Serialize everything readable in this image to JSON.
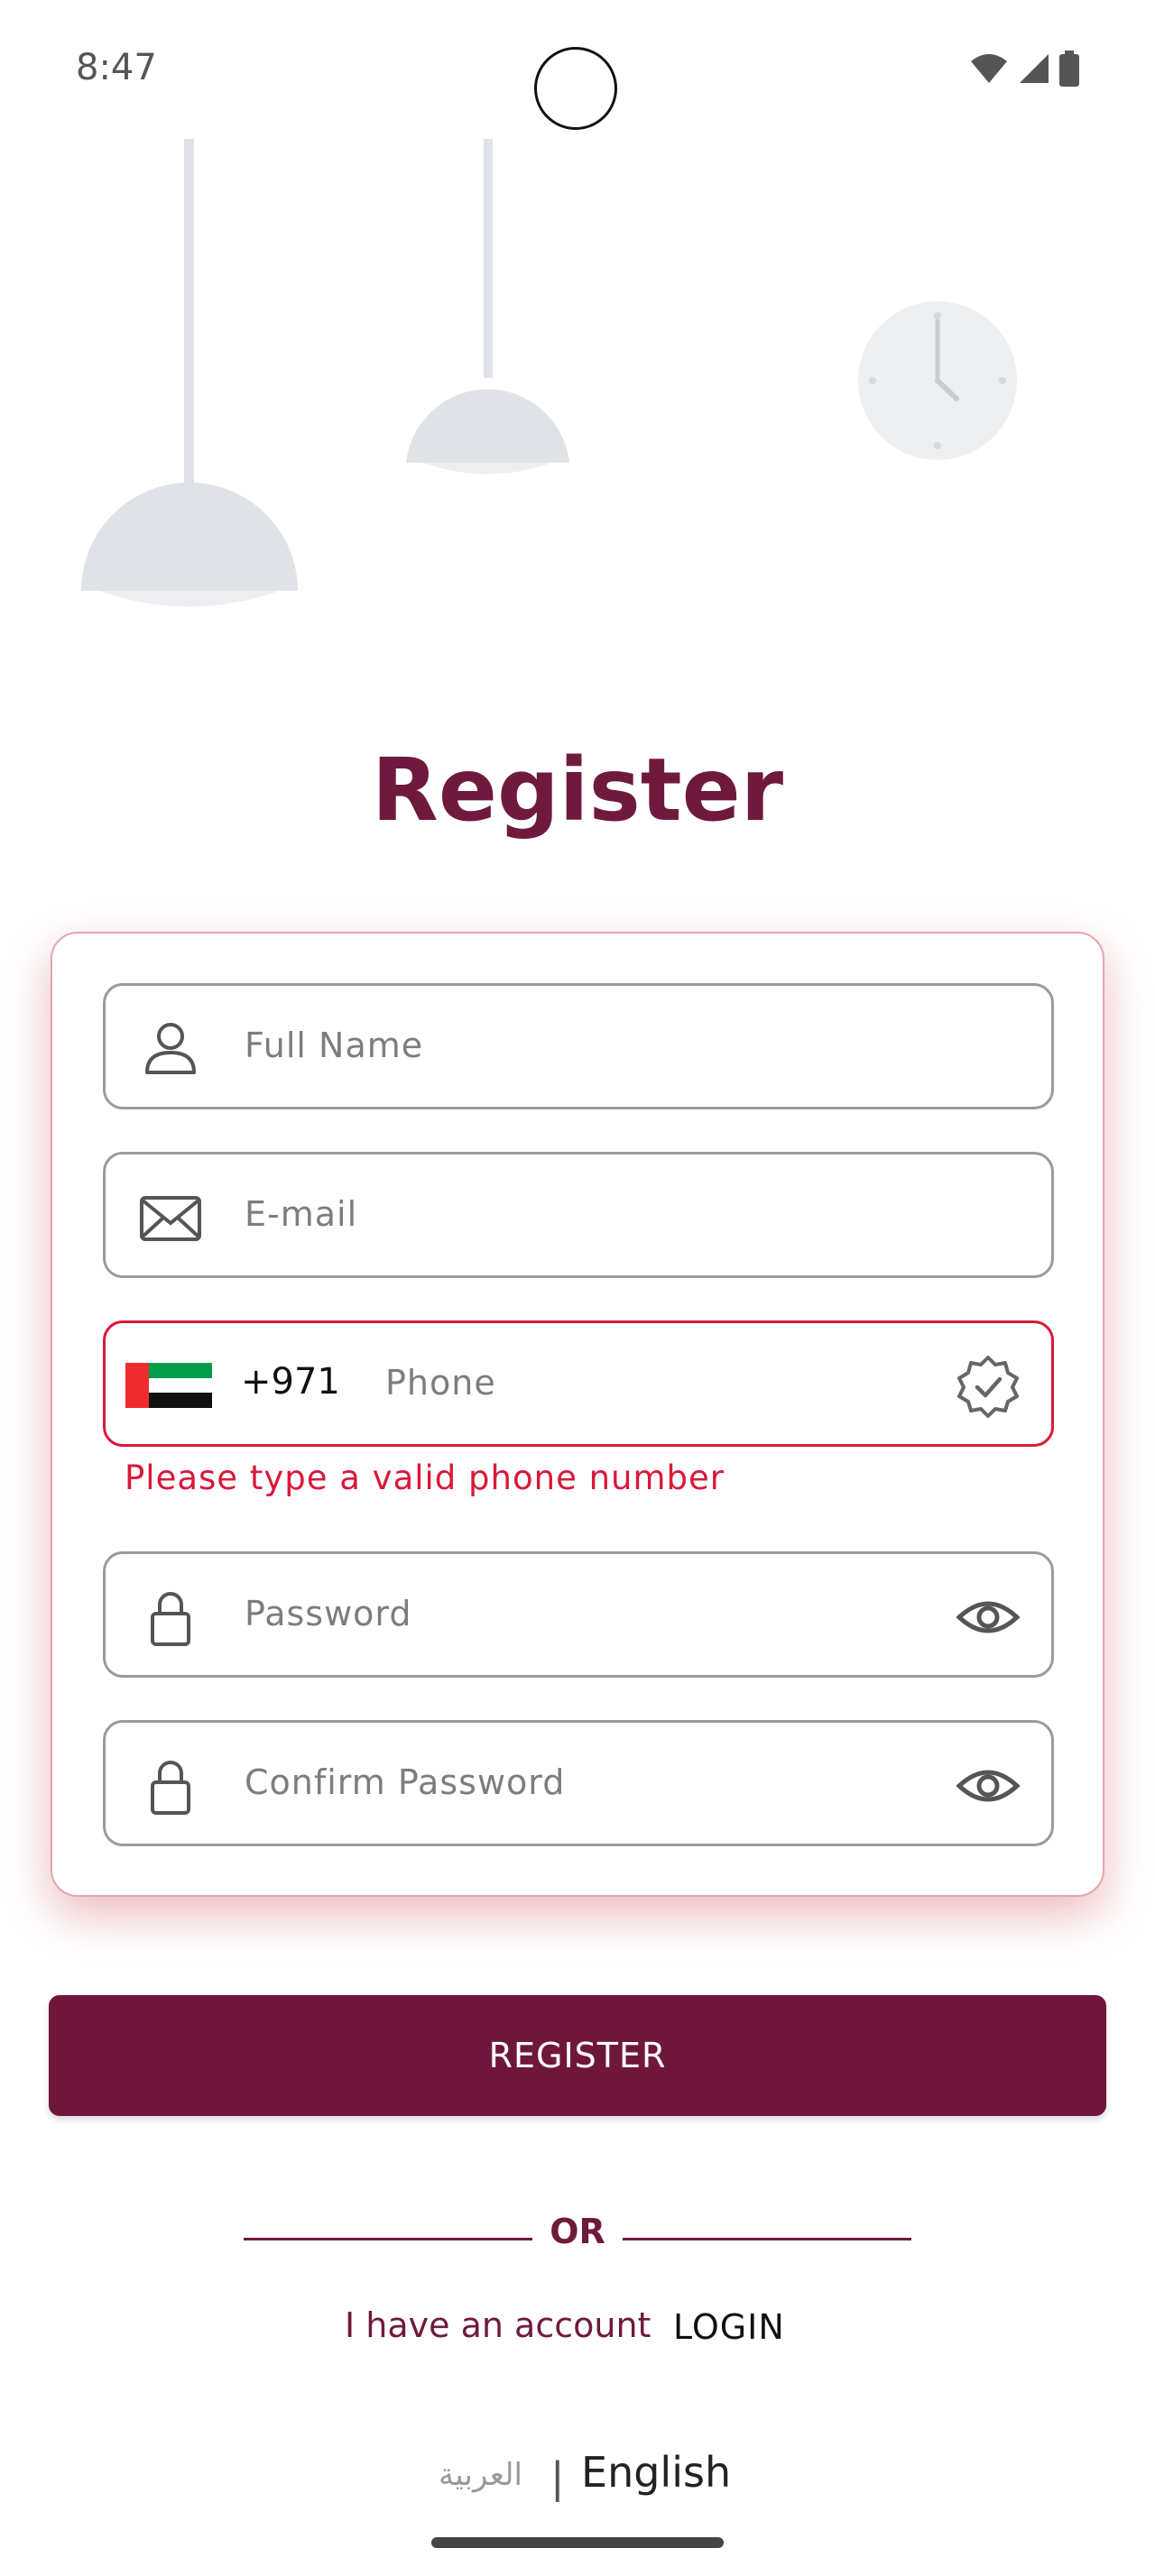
{
  "status_bar": {
    "time": "8:47"
  },
  "page": {
    "title": "Register"
  },
  "form": {
    "full_name": {
      "placeholder": "Full Name"
    },
    "email": {
      "placeholder": "E-mail"
    },
    "phone": {
      "country_code": "+971",
      "placeholder": "Phone",
      "error": "Please type a valid phone number"
    },
    "password": {
      "placeholder": "Password"
    },
    "confirm_password": {
      "placeholder": "Confirm Password"
    }
  },
  "actions": {
    "register_label": "REGISTER",
    "or_label": "OR",
    "have_account_label": "I have an account",
    "login_label": "LOGIN"
  },
  "language": {
    "arabic": "العربية",
    "separator": "|",
    "english": "English"
  },
  "colors": {
    "brand": "#6f173b",
    "error": "#d8193a",
    "field_border": "#9b9b9b"
  },
  "icons": [
    "user-icon",
    "envelope-icon",
    "uae-flag-icon",
    "verified-badge-icon",
    "lock-icon",
    "eye-icon",
    "wifi-icon",
    "signal-icon",
    "battery-icon"
  ]
}
